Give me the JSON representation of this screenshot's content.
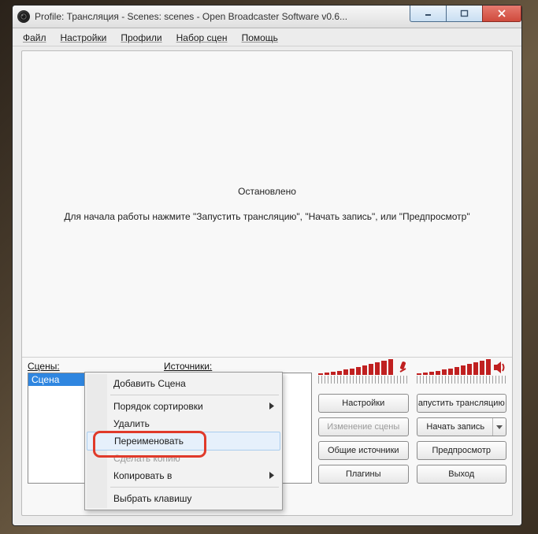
{
  "window": {
    "title": "Profile: Трансляция - Scenes: scenes - Open Broadcaster Software v0.6..."
  },
  "menubar": {
    "items": [
      "Файл",
      "Настройки",
      "Профили",
      "Набор сцен",
      "Помощь"
    ]
  },
  "preview": {
    "status": "Остановлено",
    "hint": "Для начала работы нажмите \"Запустить трансляцию\", \"Начать запись\", или \"Предпросмотр\""
  },
  "scenes": {
    "label": "Сцены:",
    "items": [
      "Сцена"
    ]
  },
  "sources": {
    "label": "Источники:"
  },
  "buttons": {
    "settings": "Настройки",
    "start_stream": "апустить трансляцию",
    "change_scene": "Изменение сцены",
    "start_record": "Начать запись",
    "global_sources": "Общие источники",
    "preview": "Предпросмотр",
    "plugins": "Плагины",
    "exit": "Выход"
  },
  "context_menu": {
    "add_scene": "Добавить Сцена",
    "sort_order": "Порядок сортировки",
    "delete": "Удалить",
    "rename": "Переименовать",
    "make_copy": "Сделать копию",
    "copy_to": "Копировать в",
    "select_key": "Выбрать клавишу"
  }
}
